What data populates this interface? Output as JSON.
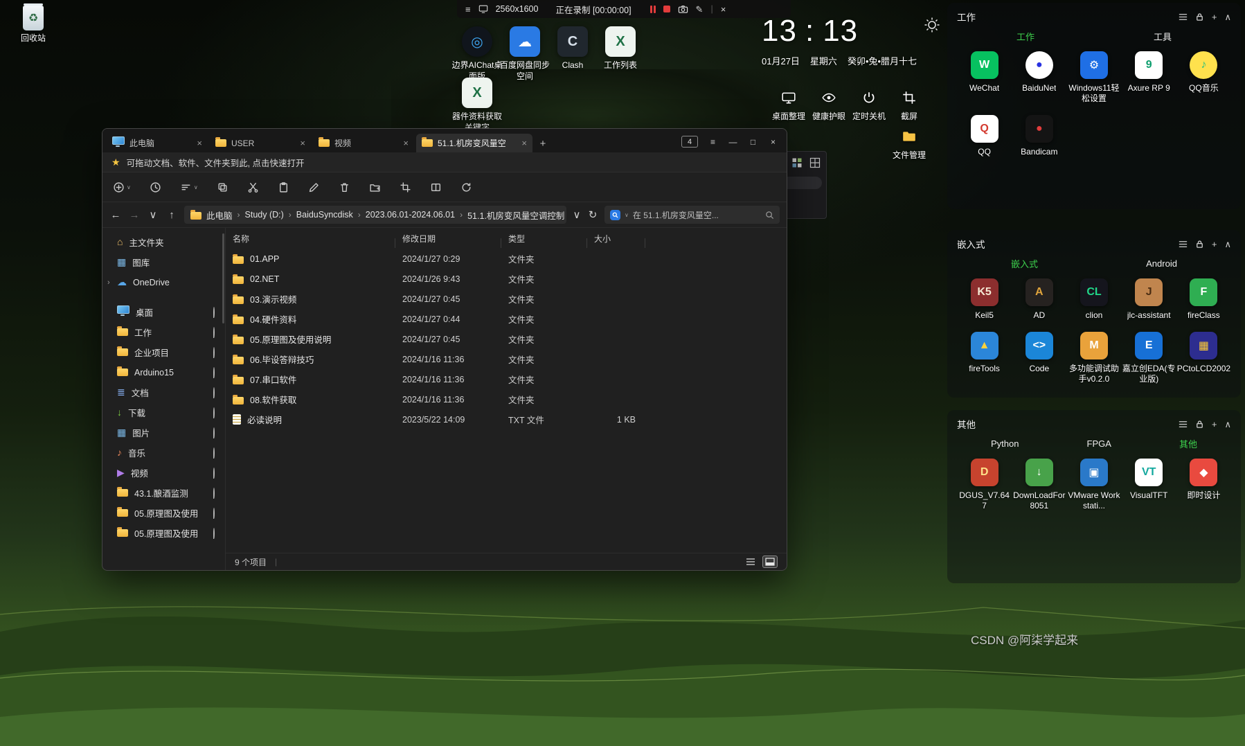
{
  "colors": {
    "panel_tab_active": "#3ed24e",
    "record_red": "#e23c3c",
    "star_yellow": "#f5c542",
    "folder_yellow": "#f6c344",
    "accent_blue": "#2a7ae4"
  },
  "recycle_bin": {
    "label": "回收站"
  },
  "recording_bar": {
    "resolution": "2560x1600",
    "status": "正在录制 [00:00:00]"
  },
  "desktop_icons": [
    {
      "name": "aichat",
      "label": "边界AIChat桌面版",
      "glyph": "◎",
      "bg": "#10151c",
      "fg": "#3fa9f5",
      "shape": "circle"
    },
    {
      "name": "baidu-sync",
      "label": "百度网盘同步空间",
      "glyph": "☁",
      "bg": "#2a7ae4",
      "fg": "#ffffff",
      "shape": "round"
    },
    {
      "name": "clash",
      "label": "Clash",
      "glyph": "C",
      "bg": "#20272e",
      "fg": "#d7e0ea",
      "shape": "round"
    },
    {
      "name": "work-list",
      "label": "工作列表",
      "glyph": "X",
      "bg": "#eef4ef",
      "fg": "#1e7145",
      "shape": "round"
    },
    {
      "name": "device-doc",
      "label": "器件资料获取关键字",
      "glyph": "X",
      "bg": "#eef4ef",
      "fg": "#1e7145",
      "shape": "round"
    }
  ],
  "clock": {
    "hours": "13",
    "minutes": "13",
    "separator": ":",
    "date": "01月27日",
    "weekday": "星期六",
    "lunar": "癸卯•兔•腊月十七"
  },
  "utility_icons": [
    {
      "name": "desktop-organize",
      "label": "桌面整理",
      "icon": "monitor"
    },
    {
      "name": "eye-care",
      "label": "健康护眼",
      "icon": "eye"
    },
    {
      "name": "timed-shutdown",
      "label": "定时关机",
      "icon": "power"
    },
    {
      "name": "screenshot",
      "label": "截屏",
      "icon": "crop"
    },
    {
      "name": "file-manager",
      "label": "文件管理",
      "icon": "folder"
    }
  ],
  "explorer": {
    "tabs": [
      {
        "label": "此电脑",
        "icon": "computer"
      },
      {
        "label": "USER",
        "icon": "folder"
      },
      {
        "label": "视频",
        "icon": "folder"
      },
      {
        "label": "51.1.机房变风量空",
        "icon": "folder",
        "active": true
      }
    ],
    "tab_count": "4",
    "pin_bar": "可拖动文档、软件、文件夹到此, 点击快速打开",
    "breadcrumbs": [
      "此电脑",
      "Study (D:)",
      "BaiduSyncdisk",
      "2023.06.01-2024.06.01",
      "51.1.机房变风量空调控制"
    ],
    "search_text": "在 51.1.机房变风量空...",
    "sidebar_main": [
      {
        "label": "主文件夹",
        "icon": "home"
      },
      {
        "label": "图库",
        "icon": "gallery"
      },
      {
        "label": "OneDrive",
        "icon": "cloud",
        "expand": true
      }
    ],
    "sidebar_pinned": [
      {
        "label": "桌面",
        "icon": "desktop",
        "pin": true
      },
      {
        "label": "工作",
        "icon": "folder",
        "pin": true
      },
      {
        "label": "企业项目",
        "icon": "folder",
        "pin": true
      },
      {
        "label": "Arduino15",
        "icon": "folder",
        "pin": true
      },
      {
        "label": "文档",
        "icon": "doc",
        "pin": true
      },
      {
        "label": "下载",
        "icon": "download",
        "pin": true
      },
      {
        "label": "图片",
        "icon": "picture",
        "pin": true
      },
      {
        "label": "音乐",
        "icon": "music",
        "pin": true
      },
      {
        "label": "视频",
        "icon": "video",
        "pin": true
      },
      {
        "label": "43.1.酿酒监测",
        "icon": "folder",
        "pin": true
      },
      {
        "label": "05.原理图及使用",
        "icon": "folder",
        "pin": true
      },
      {
        "label": "05.原理图及使用",
        "icon": "folder",
        "pin": true
      }
    ],
    "columns": [
      "名称",
      "修改日期",
      "类型",
      "大小"
    ],
    "files": [
      {
        "name": "01.APP",
        "date": "2024/1/27 0:29",
        "type": "文件夹",
        "size": "",
        "icon": "folder"
      },
      {
        "name": "02.NET",
        "date": "2024/1/26 9:43",
        "type": "文件夹",
        "size": "",
        "icon": "folder"
      },
      {
        "name": "03.演示视频",
        "date": "2024/1/27 0:45",
        "type": "文件夹",
        "size": "",
        "icon": "folder"
      },
      {
        "name": "04.硬件资料",
        "date": "2024/1/27 0:44",
        "type": "文件夹",
        "size": "",
        "icon": "folder"
      },
      {
        "name": "05.原理图及使用说明",
        "date": "2024/1/27 0:45",
        "type": "文件夹",
        "size": "",
        "icon": "folder"
      },
      {
        "name": "06.毕设答辩技巧",
        "date": "2024/1/16 11:36",
        "type": "文件夹",
        "size": "",
        "icon": "folder"
      },
      {
        "name": "07.串口软件",
        "date": "2024/1/16 11:36",
        "type": "文件夹",
        "size": "",
        "icon": "folder"
      },
      {
        "name": "08.软件获取",
        "date": "2024/1/16 11:36",
        "type": "文件夹",
        "size": "",
        "icon": "folder"
      },
      {
        "name": "必读说明",
        "date": "2023/5/22 14:09",
        "type": "TXT 文件",
        "size": "1 KB",
        "icon": "txt"
      }
    ],
    "status": "9 个项目"
  },
  "panels": [
    {
      "title": "工作",
      "tabs": [
        {
          "label": "工作",
          "active": true
        },
        {
          "label": "工具"
        }
      ],
      "apps": [
        {
          "name": "wechat",
          "label": "WeChat",
          "glyph": "W",
          "bg": "#07c160",
          "fg": "#ffffff"
        },
        {
          "name": "baidunet",
          "label": "BaiduNet",
          "glyph": "●",
          "bg": "#ffffff",
          "fg": "#2932e1",
          "shape": "circle"
        },
        {
          "name": "win11-settings",
          "label": "Windows11轻松设置",
          "glyph": "⚙",
          "bg": "#1f6fe5",
          "fg": "#ffffff"
        },
        {
          "name": "axure",
          "label": "Axure RP 9",
          "glyph": "9",
          "bg": "#ffffff",
          "fg": "#0e9e6e"
        },
        {
          "name": "qq-music",
          "label": "QQ音乐",
          "glyph": "♪",
          "bg": "#ffe14d",
          "fg": "#31c27c",
          "shape": "circle"
        },
        {
          "name": "qq",
          "label": "QQ",
          "glyph": "Q",
          "bg": "#ffffff",
          "fg": "#d33a2f"
        },
        {
          "name": "bandicam",
          "label": "Bandicam",
          "glyph": "●",
          "bg": "#141414",
          "fg": "#e23c3c"
        }
      ]
    },
    {
      "title": "嵌入式",
      "tabs": [
        {
          "label": "嵌入式",
          "active": true
        },
        {
          "label": "Android"
        }
      ],
      "apps": [
        {
          "name": "keil5",
          "label": "Keil5",
          "glyph": "K5",
          "bg": "#8c2e2e",
          "fg": "#f5e9d5"
        },
        {
          "name": "altium",
          "label": "AD",
          "glyph": "A",
          "bg": "#262220",
          "fg": "#e0a43c"
        },
        {
          "name": "clion",
          "label": "clion",
          "glyph": "CL",
          "bg": "#15151d",
          "fg": "#21d789"
        },
        {
          "name": "jlc-assistant",
          "label": "jlc-assistant",
          "glyph": "J",
          "bg": "#c0854e",
          "fg": "#4a2c12"
        },
        {
          "name": "fireclass",
          "label": "fireClass",
          "glyph": "F",
          "bg": "#2fae52",
          "fg": "#ffffff"
        },
        {
          "name": "firetools",
          "label": "fireTools",
          "glyph": "▲",
          "bg": "#2b86d9",
          "fg": "#ffd13c"
        },
        {
          "name": "vscode",
          "label": "Code",
          "glyph": "<>",
          "bg": "#1b86d8",
          "fg": "#ffffff"
        },
        {
          "name": "debug-assistant",
          "label": "多功能调试助手v0.2.0",
          "glyph": "M",
          "bg": "#e9a23b",
          "fg": "#ffffff"
        },
        {
          "name": "jlc-eda",
          "label": "嘉立创EDA(专业版)",
          "glyph": "E",
          "bg": "#1770d6",
          "fg": "#ffffff"
        },
        {
          "name": "pctolcd",
          "label": "PCtoLCD2002",
          "glyph": "▦",
          "bg": "#2d2d8f",
          "fg": "#ffcc33"
        }
      ]
    },
    {
      "title": "其他",
      "tabs": [
        {
          "label": "Python"
        },
        {
          "label": "FPGA"
        },
        {
          "label": "其他",
          "active": true
        }
      ],
      "apps": [
        {
          "name": "dgus",
          "label": "DGUS_V7.647",
          "glyph": "D",
          "bg": "#c7432e",
          "fg": "#ffe28a"
        },
        {
          "name": "downloadfor8051",
          "label": "DownLoadFor8051",
          "glyph": "↓",
          "bg": "#48a24a",
          "fg": "#ffffff"
        },
        {
          "name": "vmware",
          "label": "VMware Workstati...",
          "glyph": "▣",
          "bg": "#2a79c9",
          "fg": "#ffffff"
        },
        {
          "name": "visualtft",
          "label": "VisualTFT",
          "glyph": "VT",
          "bg": "#ffffff",
          "fg": "#13a89e"
        },
        {
          "name": "jishisheji",
          "label": "即时设计",
          "glyph": "◆",
          "bg": "#e94a3f",
          "fg": "#ffffff"
        }
      ]
    }
  ],
  "watermark": {
    "text": "CSDN @阿柒学起来"
  }
}
